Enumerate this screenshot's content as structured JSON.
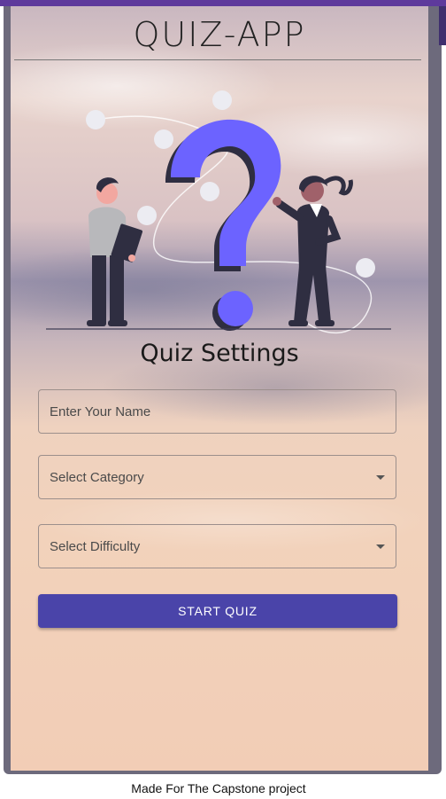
{
  "app": {
    "title": "QUIZ-APP"
  },
  "settings": {
    "heading": "Quiz Settings",
    "name_placeholder": "Enter Your Name",
    "category_label": "Select Category",
    "difficulty_label": "Select Difficulty",
    "start_label": "START QUIZ"
  },
  "footer": {
    "text": "Made For The Capstone project"
  },
  "colors": {
    "accent": "#4a44a9",
    "topbar": "#5e3a9c",
    "question_mark": "#6c63ff"
  },
  "icons": {
    "category_dropdown": "chevron-down-icon",
    "difficulty_dropdown": "chevron-down-icon"
  }
}
